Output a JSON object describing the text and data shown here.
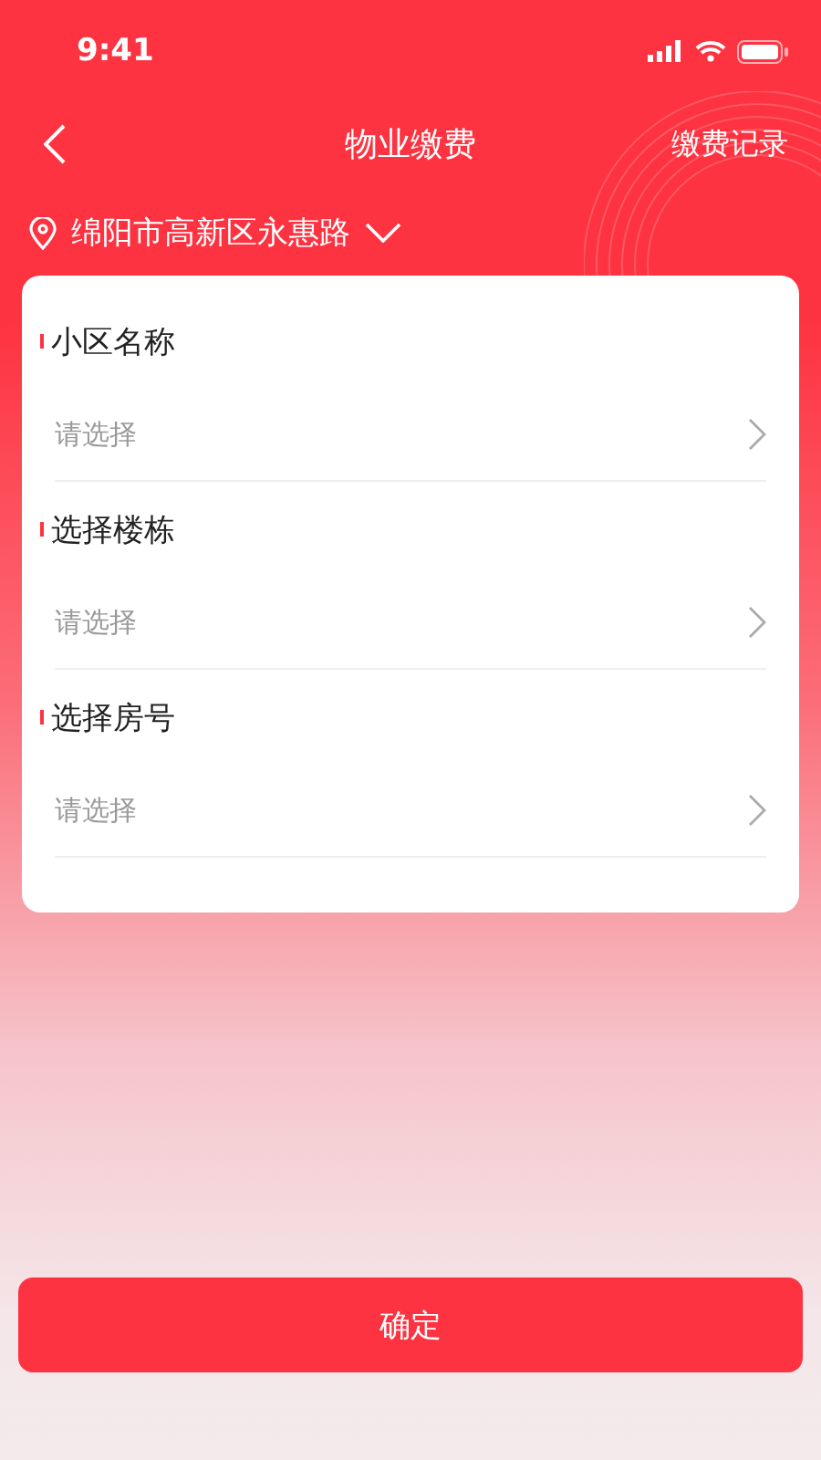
{
  "status_bar": {
    "time": "9:41"
  },
  "nav": {
    "title": "物业缴费",
    "action": "缴费记录"
  },
  "location": {
    "text": "绵阳市高新区永惠路"
  },
  "form": {
    "fields": [
      {
        "label": "小区名称",
        "required": true,
        "placeholder": "请选择"
      },
      {
        "label": "选择楼栋",
        "required": true,
        "placeholder": "请选择"
      },
      {
        "label": "选择房号",
        "required": true,
        "placeholder": "请选择"
      }
    ]
  },
  "confirm_button": "确定"
}
